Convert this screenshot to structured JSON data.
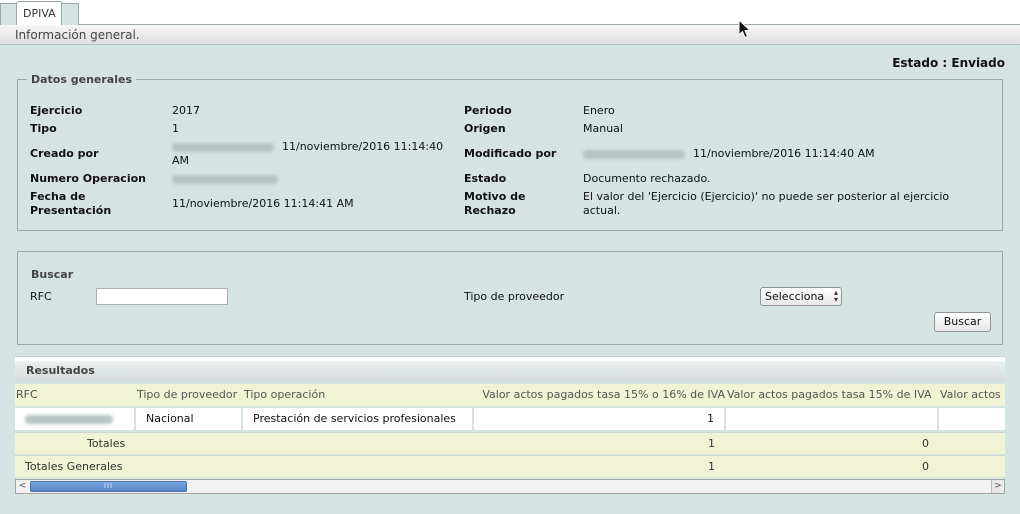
{
  "tabs": {
    "active": "DPIVA"
  },
  "subheader": "Información general.",
  "estado": "Estado : Enviado",
  "datos_generales": {
    "legend": "Datos generales",
    "ejercicio": {
      "label": "Ejercicio",
      "value": "2017"
    },
    "tipo": {
      "label": "Tipo",
      "value": "1"
    },
    "creado_por": {
      "label": "Creado por",
      "value": "11/noviembre/2016 11:14:40 AM"
    },
    "numero_operacion": {
      "label": "Numero Operacion"
    },
    "fecha_presentacion": {
      "label": "Fecha de Presentación",
      "value": "11/noviembre/2016 11:14:41 AM"
    },
    "periodo": {
      "label": "Periodo",
      "value": "Enero"
    },
    "origen": {
      "label": "Origen",
      "value": "Manual"
    },
    "modificado_por": {
      "label": "Modificado por",
      "value": "11/noviembre/2016 11:14:40 AM"
    },
    "estado": {
      "label": "Estado",
      "value": "Documento rechazado."
    },
    "motivo_rechazo": {
      "label": "Motivo de Rechazo",
      "value": "El valor del 'Ejercicio (Ejercicio)' no puede ser posterior al ejercicio actual."
    }
  },
  "buscar": {
    "title": "Buscar",
    "rfc_label": "RFC",
    "rfc_value": "",
    "tipo_proveedor_label": "Tipo de proveedor",
    "tipo_proveedor_selected": "Selecciona",
    "button": "Buscar"
  },
  "resultados": {
    "title": "Resultados",
    "columns": [
      "RFC",
      "Tipo de proveedor",
      "Tipo operación",
      "Valor actos pagados tasa 15% o 16% de IVA",
      "Valor actos pagados tasa 15% de IVA",
      "Valor actos"
    ],
    "row": {
      "tipo_proveedor": "Nacional",
      "tipo_operacion": "Prestación de servicios profesionales",
      "valor_15_16": "1",
      "valor_15": ""
    },
    "totales": {
      "label": "Totales",
      "valor_15_16": "1",
      "valor_15": "0"
    },
    "totales_generales": {
      "label": "Totales Generales",
      "valor_15_16": "1",
      "valor_15": "0"
    }
  },
  "scrollbar": {
    "thumb_grip": "III"
  },
  "icons": {
    "scroll_left": "scroll-left-icon",
    "scroll_right": "scroll-right-icon",
    "cursor": "mouse-cursor-icon",
    "select_arrows": "up-down-arrows-icon"
  }
}
